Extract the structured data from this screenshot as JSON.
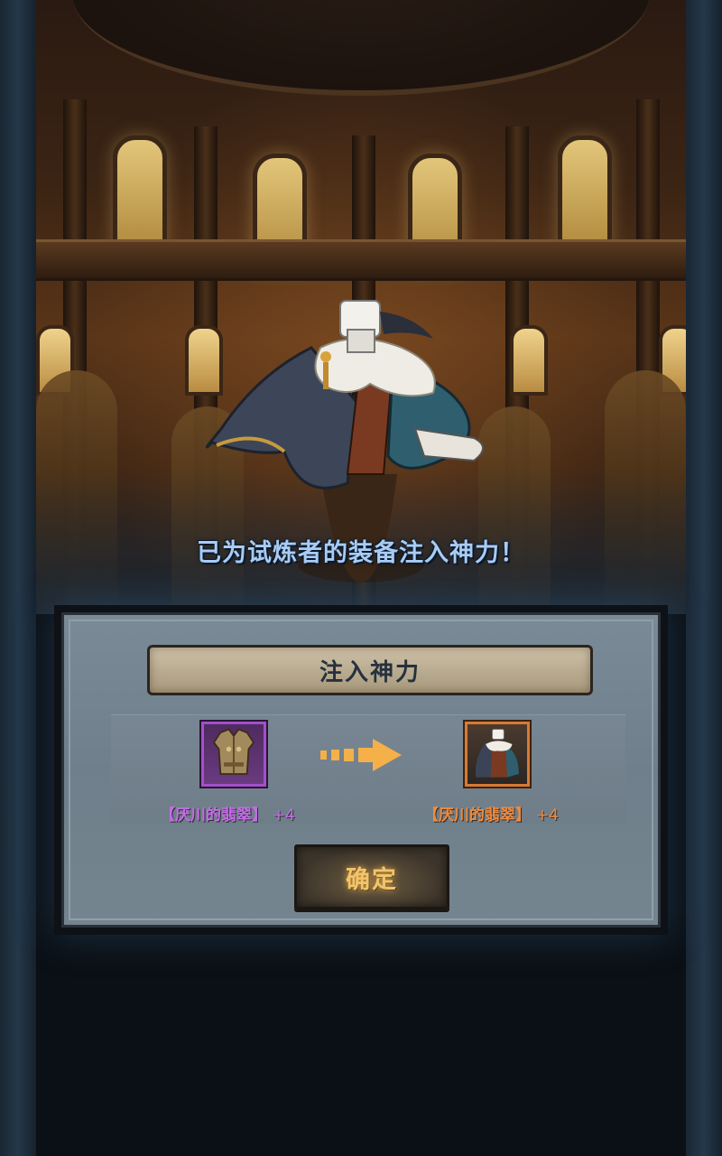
{
  "message": "已为试炼者的装备注入神力！",
  "dialog": {
    "title": "注入神力",
    "from_item": {
      "name": "【厌川的翡翠】",
      "level": "+4",
      "rarity": "purple",
      "icon": "bronze-armor-icon"
    },
    "to_item": {
      "name": "【厌川的翡翠】",
      "level": "+4",
      "rarity": "orange",
      "icon": "cloaked-armor-icon"
    },
    "confirm_label": "确定"
  },
  "colors": {
    "purple": "#c66be6",
    "orange": "#f08a3c",
    "message": "#a9ccf4",
    "confirm": "#f2c46a"
  }
}
